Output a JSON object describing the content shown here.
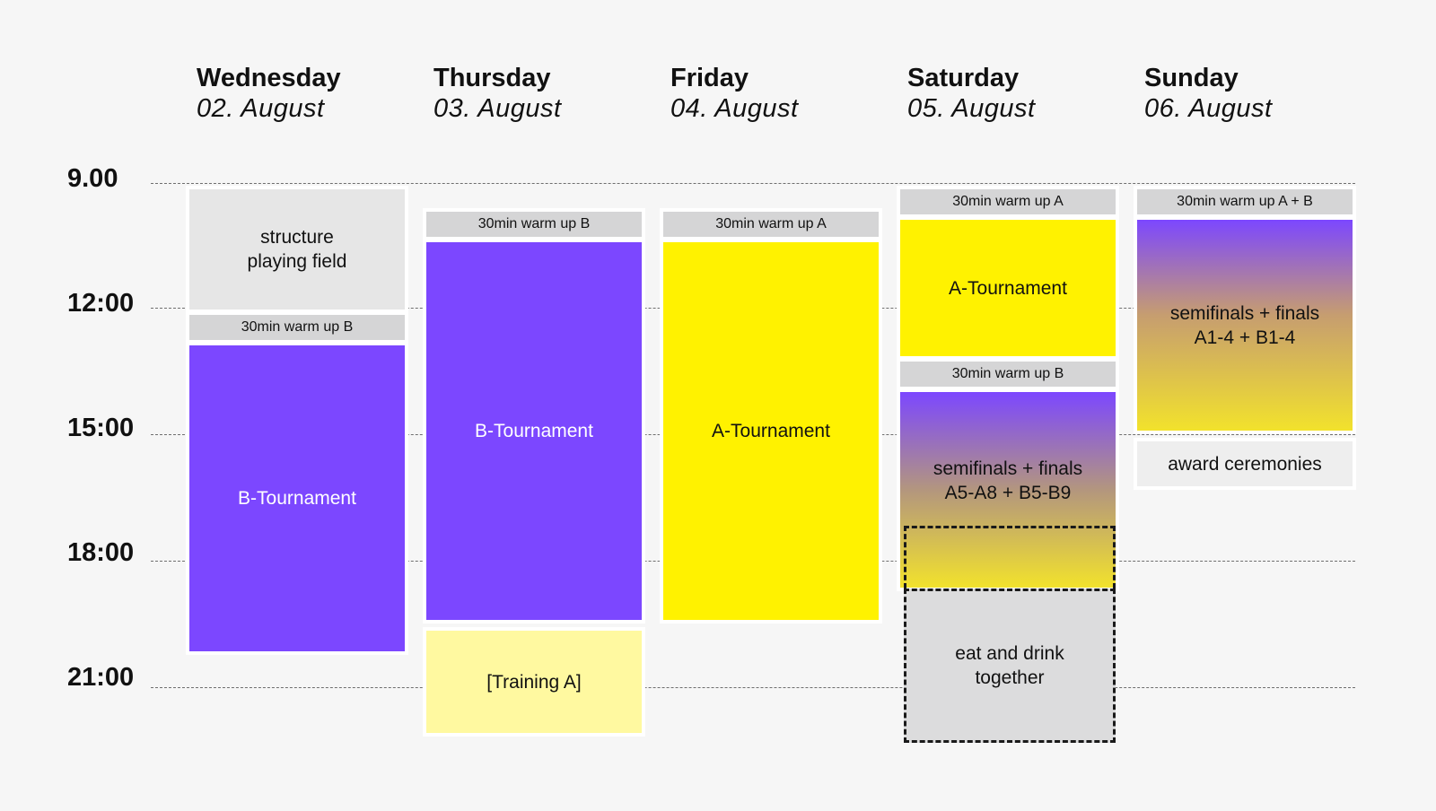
{
  "days": [
    {
      "name": "Wednesday",
      "date": "02. August"
    },
    {
      "name": "Thursday",
      "date": "03. August"
    },
    {
      "name": "Friday",
      "date": "04. August"
    },
    {
      "name": "Saturday",
      "date": "05. August"
    },
    {
      "name": "Sunday",
      "date": "06. August"
    }
  ],
  "times": [
    "9.00",
    "12:00",
    "15:00",
    "18:00",
    "21:00"
  ],
  "events": {
    "wed_structure": "structure\nplaying field",
    "wed_warmup": "30min warm up B",
    "wed_tournament": "B-Tournament",
    "thu_warmup": "30min warm up B",
    "thu_tournament": "B-Tournament",
    "thu_training": "[Training A]",
    "fri_warmup": "30min warm up A",
    "fri_tournament": "A-Tournament",
    "sat_warmup_a": "30min warm up A",
    "sat_tournament": "A-Tournament",
    "sat_warmup_b": "30min warm up B",
    "sat_finals": "semifinals + finals\nA5-A8 + B5-B9",
    "sat_eat": "eat and drink\ntogether",
    "sun_warmup": "30min warm up A + B",
    "sun_finals": "semifinals + finals\nA1-4 + B1-4",
    "sun_award": "award ceremonies"
  },
  "colors": {
    "purple": "#7c47ff",
    "yellow": "#fff200",
    "light_yellow": "#fff9a0",
    "grey": "#e6e6e6",
    "warm_up_grey": "#d5d5d6",
    "background": "#f6f6f6"
  }
}
